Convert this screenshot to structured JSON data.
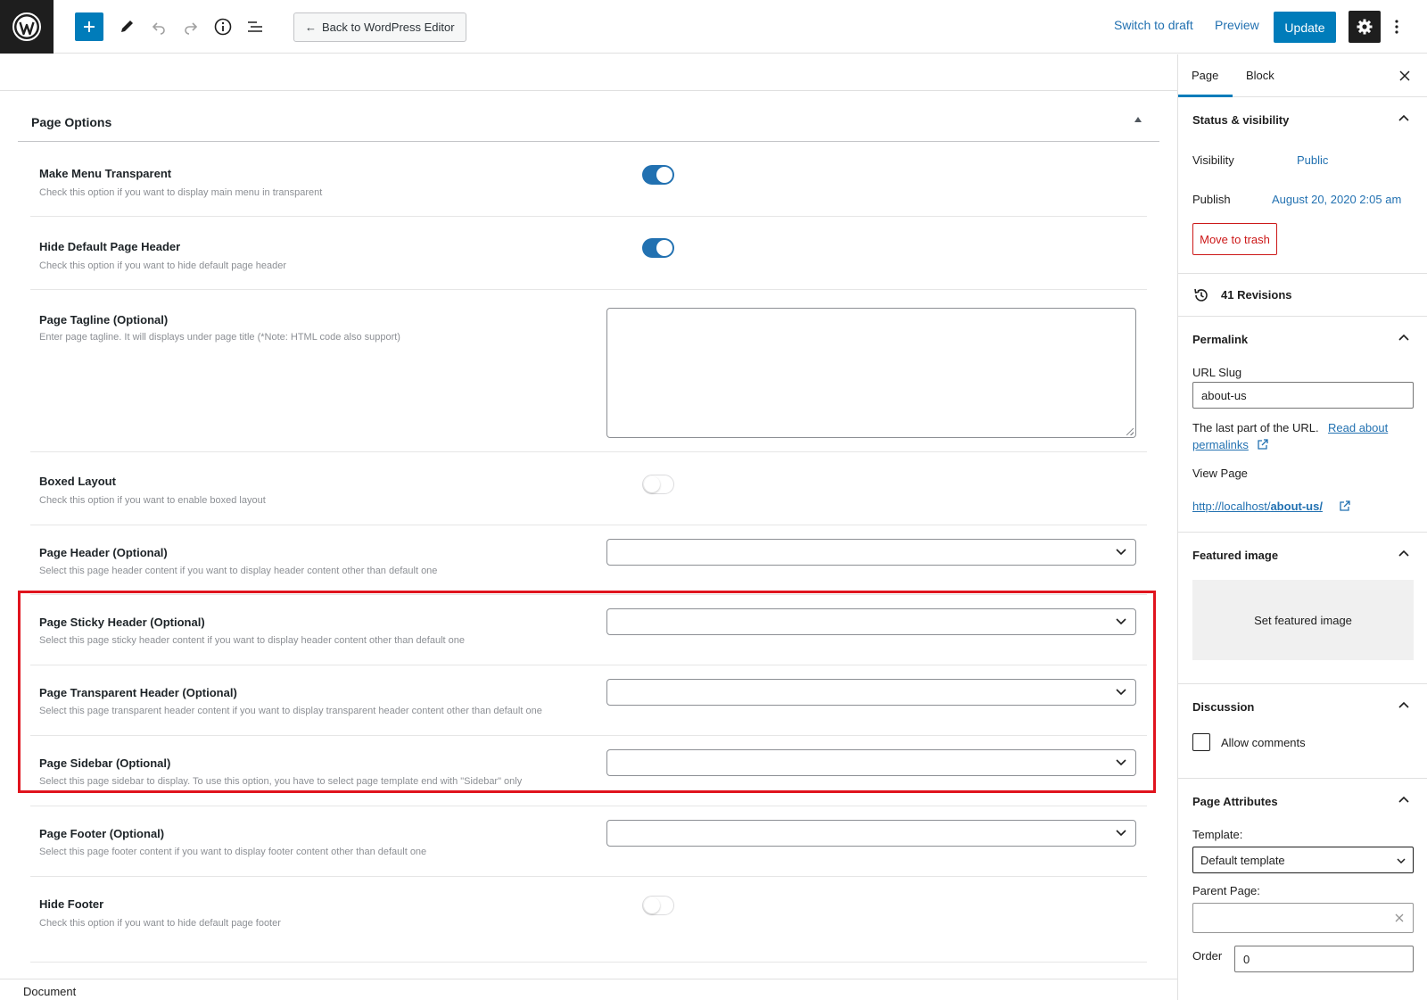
{
  "toolbar": {
    "back_label": "Back to WordPress Editor",
    "switch_draft_label": "Switch to draft",
    "preview_label": "Preview",
    "update_label": "Update"
  },
  "panel": {
    "title": "Page Options",
    "options": [
      {
        "label": "Make Menu Transparent",
        "desc": "Check this option if you want to display main menu in transparent",
        "control": "toggle",
        "value": true
      },
      {
        "label": "Hide Default Page Header",
        "desc": "Check this option if you want to hide default page header",
        "control": "toggle",
        "value": true
      },
      {
        "label": "Page Tagline (Optional)",
        "desc": "Enter page tagline. It will displays under page title (*Note: HTML code also support)",
        "control": "textarea",
        "value": ""
      },
      {
        "label": "Boxed Layout",
        "desc": "Check this option if you want to enable boxed layout",
        "control": "toggle",
        "value": false
      },
      {
        "label": "Page Header (Optional)",
        "desc": "Select this page header content if you want to display header content other than default one",
        "control": "select",
        "value": ""
      },
      {
        "label": "Page Sticky Header (Optional)",
        "desc": "Select this page sticky header content if you want to display header content other than default one",
        "control": "select",
        "value": ""
      },
      {
        "label": "Page Transparent Header (Optional)",
        "desc": "Select this page transparent header content if you want to display transparent header content other than default one",
        "control": "select",
        "value": ""
      },
      {
        "label": "Page Sidebar (Optional)",
        "desc": "Select this page sidebar to display. To use this option, you have to select page template end with \"Sidebar\" only",
        "control": "select",
        "value": ""
      },
      {
        "label": "Page Footer (Optional)",
        "desc": "Select this page footer content if you want to display footer content other than default one",
        "control": "select",
        "value": ""
      },
      {
        "label": "Hide Footer",
        "desc": "Check this option if you want to hide default page footer",
        "control": "toggle",
        "value": false
      }
    ]
  },
  "footer": {
    "label": "Document"
  },
  "sidebar": {
    "tabs": [
      "Page",
      "Block"
    ],
    "status": {
      "title": "Status & visibility",
      "visibility_label": "Visibility",
      "visibility_value": "Public",
      "publish_label": "Publish",
      "publish_value": "August 20, 2020 2:05 am",
      "trash_label": "Move to trash"
    },
    "revisions": {
      "label": "41 Revisions"
    },
    "permalink": {
      "title": "Permalink",
      "slug_label": "URL Slug",
      "slug_value": "about-us",
      "help_text": "The last part of the URL.",
      "help_link_1": "Read about",
      "help_link_2": "permalinks",
      "view_label": "View Page",
      "url_prefix": "http://localhost/",
      "url_slug": "about-us/"
    },
    "featured": {
      "title": "Featured image",
      "button_label": "Set featured image"
    },
    "discussion": {
      "title": "Discussion",
      "checkbox_label": "Allow comments",
      "checked": false
    },
    "attributes": {
      "title": "Page Attributes",
      "template_label": "Template:",
      "template_value": "Default template",
      "parent_label": "Parent Page:",
      "parent_value": "",
      "order_label": "Order",
      "order_value": "0"
    }
  },
  "colors": {
    "accent": "#007cba",
    "highlight_border": "#e0141e",
    "danger": "#cc1818"
  }
}
